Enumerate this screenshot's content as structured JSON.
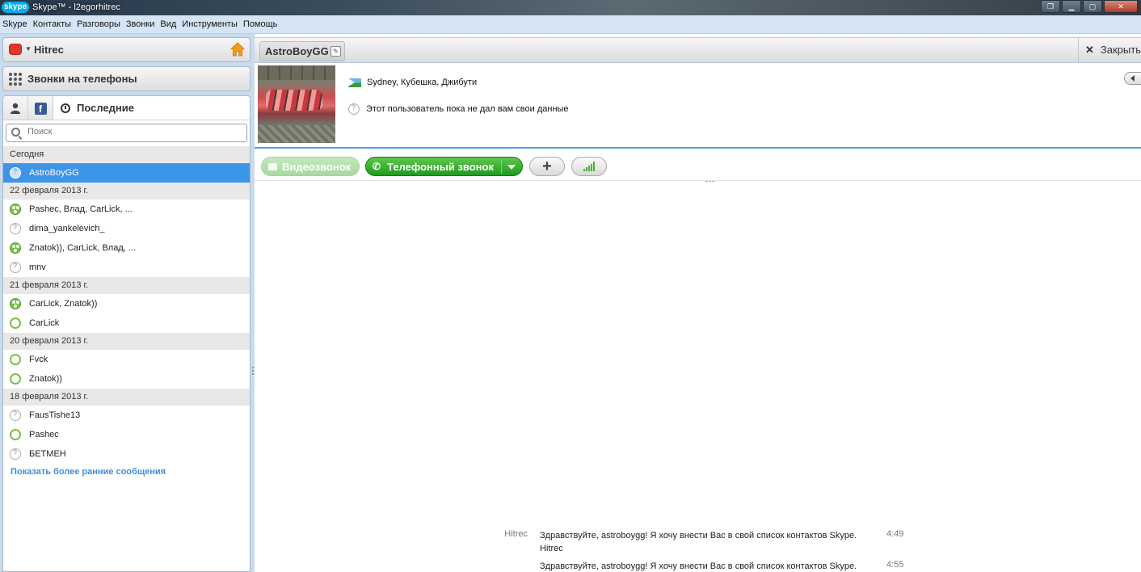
{
  "window": {
    "logo": "skype",
    "title": "Skype™ - l2egorhitrec",
    "controls": [
      "restore-icon",
      "minimize-icon",
      "maximize-icon",
      "close-icon"
    ]
  },
  "menu": [
    "Skype",
    "Контакты",
    "Разговоры",
    "Звонки",
    "Вид",
    "Инструменты",
    "Помощь"
  ],
  "profile": {
    "name": "Hitrec",
    "status_color": "#e0362b"
  },
  "calls": {
    "label": "Звонки на телефоны"
  },
  "tabs": {
    "recent_label": "Последние"
  },
  "search": {
    "placeholder": "Поиск"
  },
  "recent": [
    {
      "date": "Сегодня",
      "items": [
        {
          "name": "AstroBoyGG",
          "icon": "unknown",
          "selected": true
        }
      ]
    },
    {
      "date": "22 февраля 2013 г.",
      "items": [
        {
          "name": "Pashec, Влад, CarLick, ...",
          "icon": "group"
        },
        {
          "name": "dima_yankelevich_",
          "icon": "unknown"
        },
        {
          "name": "Znatok)), CarLick, Влад, ...",
          "icon": "group"
        },
        {
          "name": "mnv",
          "icon": "unknown"
        }
      ]
    },
    {
      "date": "21 февраля 2013 г.",
      "items": [
        {
          "name": "CarLick, Znatok))",
          "icon": "group"
        },
        {
          "name": "CarLick",
          "icon": "online"
        }
      ]
    },
    {
      "date": "20 февраля 2013 г.",
      "items": [
        {
          "name": "Fvck",
          "icon": "online"
        },
        {
          "name": "Znatok))",
          "icon": "online"
        }
      ]
    },
    {
      "date": "18 февраля 2013 г.",
      "items": [
        {
          "name": "FausTishe13",
          "icon": "unknown"
        },
        {
          "name": "Pashec",
          "icon": "online"
        },
        {
          "name": "БЕТМЕН",
          "icon": "unknown"
        }
      ]
    }
  ],
  "show_more": "Показать более ранние сообщения",
  "conversation": {
    "contact": "AstroBoyGG",
    "close_label": "Закрыть",
    "location": "Sydney, Кубешка, Джибути",
    "info_note": "Этот пользователь пока не дал вам свои данные",
    "video_call": "Видеозвонок",
    "phone_call": "Телефонный звонок",
    "add_symbol": "+",
    "accent_color": "#1f9a20"
  },
  "messages": [
    {
      "author": "Hitrec",
      "text": "Здравствуйте, astroboygg! Я хочу внести Вас в свой список контактов Skype.",
      "text2": "Hitrec",
      "time": "4:49"
    },
    {
      "author": "",
      "text": "Здравствуйте, astroboygg! Я хочу внести Вас в свой список контактов Skype.",
      "text2": "",
      "time": "4:55"
    }
  ]
}
